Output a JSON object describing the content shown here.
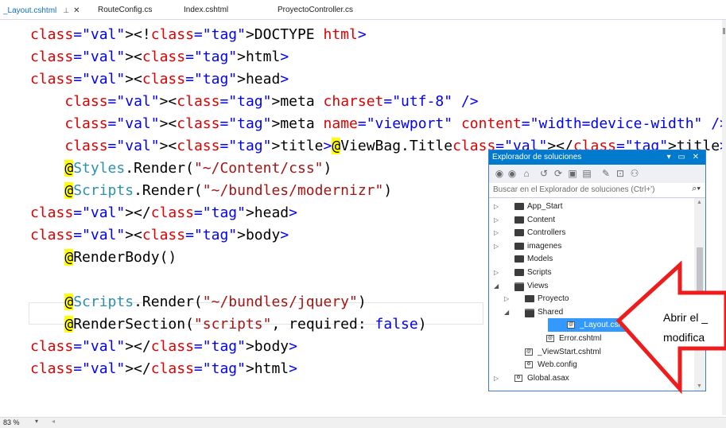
{
  "tabs": [
    {
      "label": "_Layout.cshtml",
      "active": true
    },
    {
      "label": "RouteConfig.cs",
      "active": false
    },
    {
      "label": "Index.cshtml",
      "active": false
    },
    {
      "label": "ProyectoController.cs",
      "active": false
    }
  ],
  "tab_pin_icon": "pin-icon",
  "tab_close_icon": "close-icon",
  "code_lines": [
    "<!DOCTYPE html>",
    "<html>",
    "<head>",
    "    <meta charset=\"utf-8\" />",
    "    <meta name=\"viewport\" content=\"width=device-width\" />",
    "    <title>@ViewBag.Title</title>",
    "    @Styles.Render(\"~/Content/css\")",
    "    @Scripts.Render(\"~/bundles/modernizr\")",
    "</head>",
    "<body>",
    "    @RenderBody()",
    "",
    "    @Scripts.Render(\"~/bundles/jquery\")",
    "    @RenderSection(\"scripts\", required: false)",
    "</body>",
    "</html>"
  ],
  "status": {
    "zoom": "83 %"
  },
  "solution_explorer": {
    "title": "Explorador de soluciones",
    "title_controls": "▾ ▭ ✕",
    "search_placeholder": "Buscar en el Explorador de soluciones (Ctrl+')",
    "toolbar_icons": [
      "back-icon",
      "forward-icon",
      "home-icon",
      "history-icon",
      "refresh-icon",
      "collapse-icon",
      "show-all-icon",
      "properties-icon",
      "preview-icon",
      "view-icon"
    ],
    "tree": [
      {
        "label": "App_Start",
        "level": 0,
        "expander": "▷",
        "icon": "folder"
      },
      {
        "label": "Content",
        "level": 0,
        "expander": "▷",
        "icon": "folder"
      },
      {
        "label": "Controllers",
        "level": 0,
        "expander": "▷",
        "icon": "folder"
      },
      {
        "label": "imagenes",
        "level": 0,
        "expander": "▷",
        "icon": "folder"
      },
      {
        "label": "Models",
        "level": 0,
        "expander": "",
        "icon": "folder"
      },
      {
        "label": "Scripts",
        "level": 0,
        "expander": "▷",
        "icon": "folder"
      },
      {
        "label": "Views",
        "level": 0,
        "expander": "◢",
        "icon": "folder-open"
      },
      {
        "label": "Proyecto",
        "level": 1,
        "expander": "▷",
        "icon": "folder"
      },
      {
        "label": "Shared",
        "level": 1,
        "expander": "◢",
        "icon": "folder-open"
      },
      {
        "label": "_Layout.cshtml",
        "level": 2,
        "expander": "",
        "icon": "razor-file",
        "selected": true
      },
      {
        "label": "Error.cshtml",
        "level": 2,
        "expander": "",
        "icon": "razor-file"
      },
      {
        "label": "_ViewStart.cshtml",
        "level": 1,
        "expander": "",
        "icon": "razor-file"
      },
      {
        "label": "Web.config",
        "level": 1,
        "expander": "",
        "icon": "config-file"
      },
      {
        "label": "Global.asax",
        "level": 0,
        "expander": "▷",
        "icon": "config-file"
      }
    ]
  },
  "callout": {
    "line1": "Abrir el _",
    "line2": "modifica",
    "color": "#ee1c1c"
  },
  "colors": {
    "accent": "#007acc",
    "selection": "#3399ff",
    "razor_highlight": "#ffff00"
  }
}
